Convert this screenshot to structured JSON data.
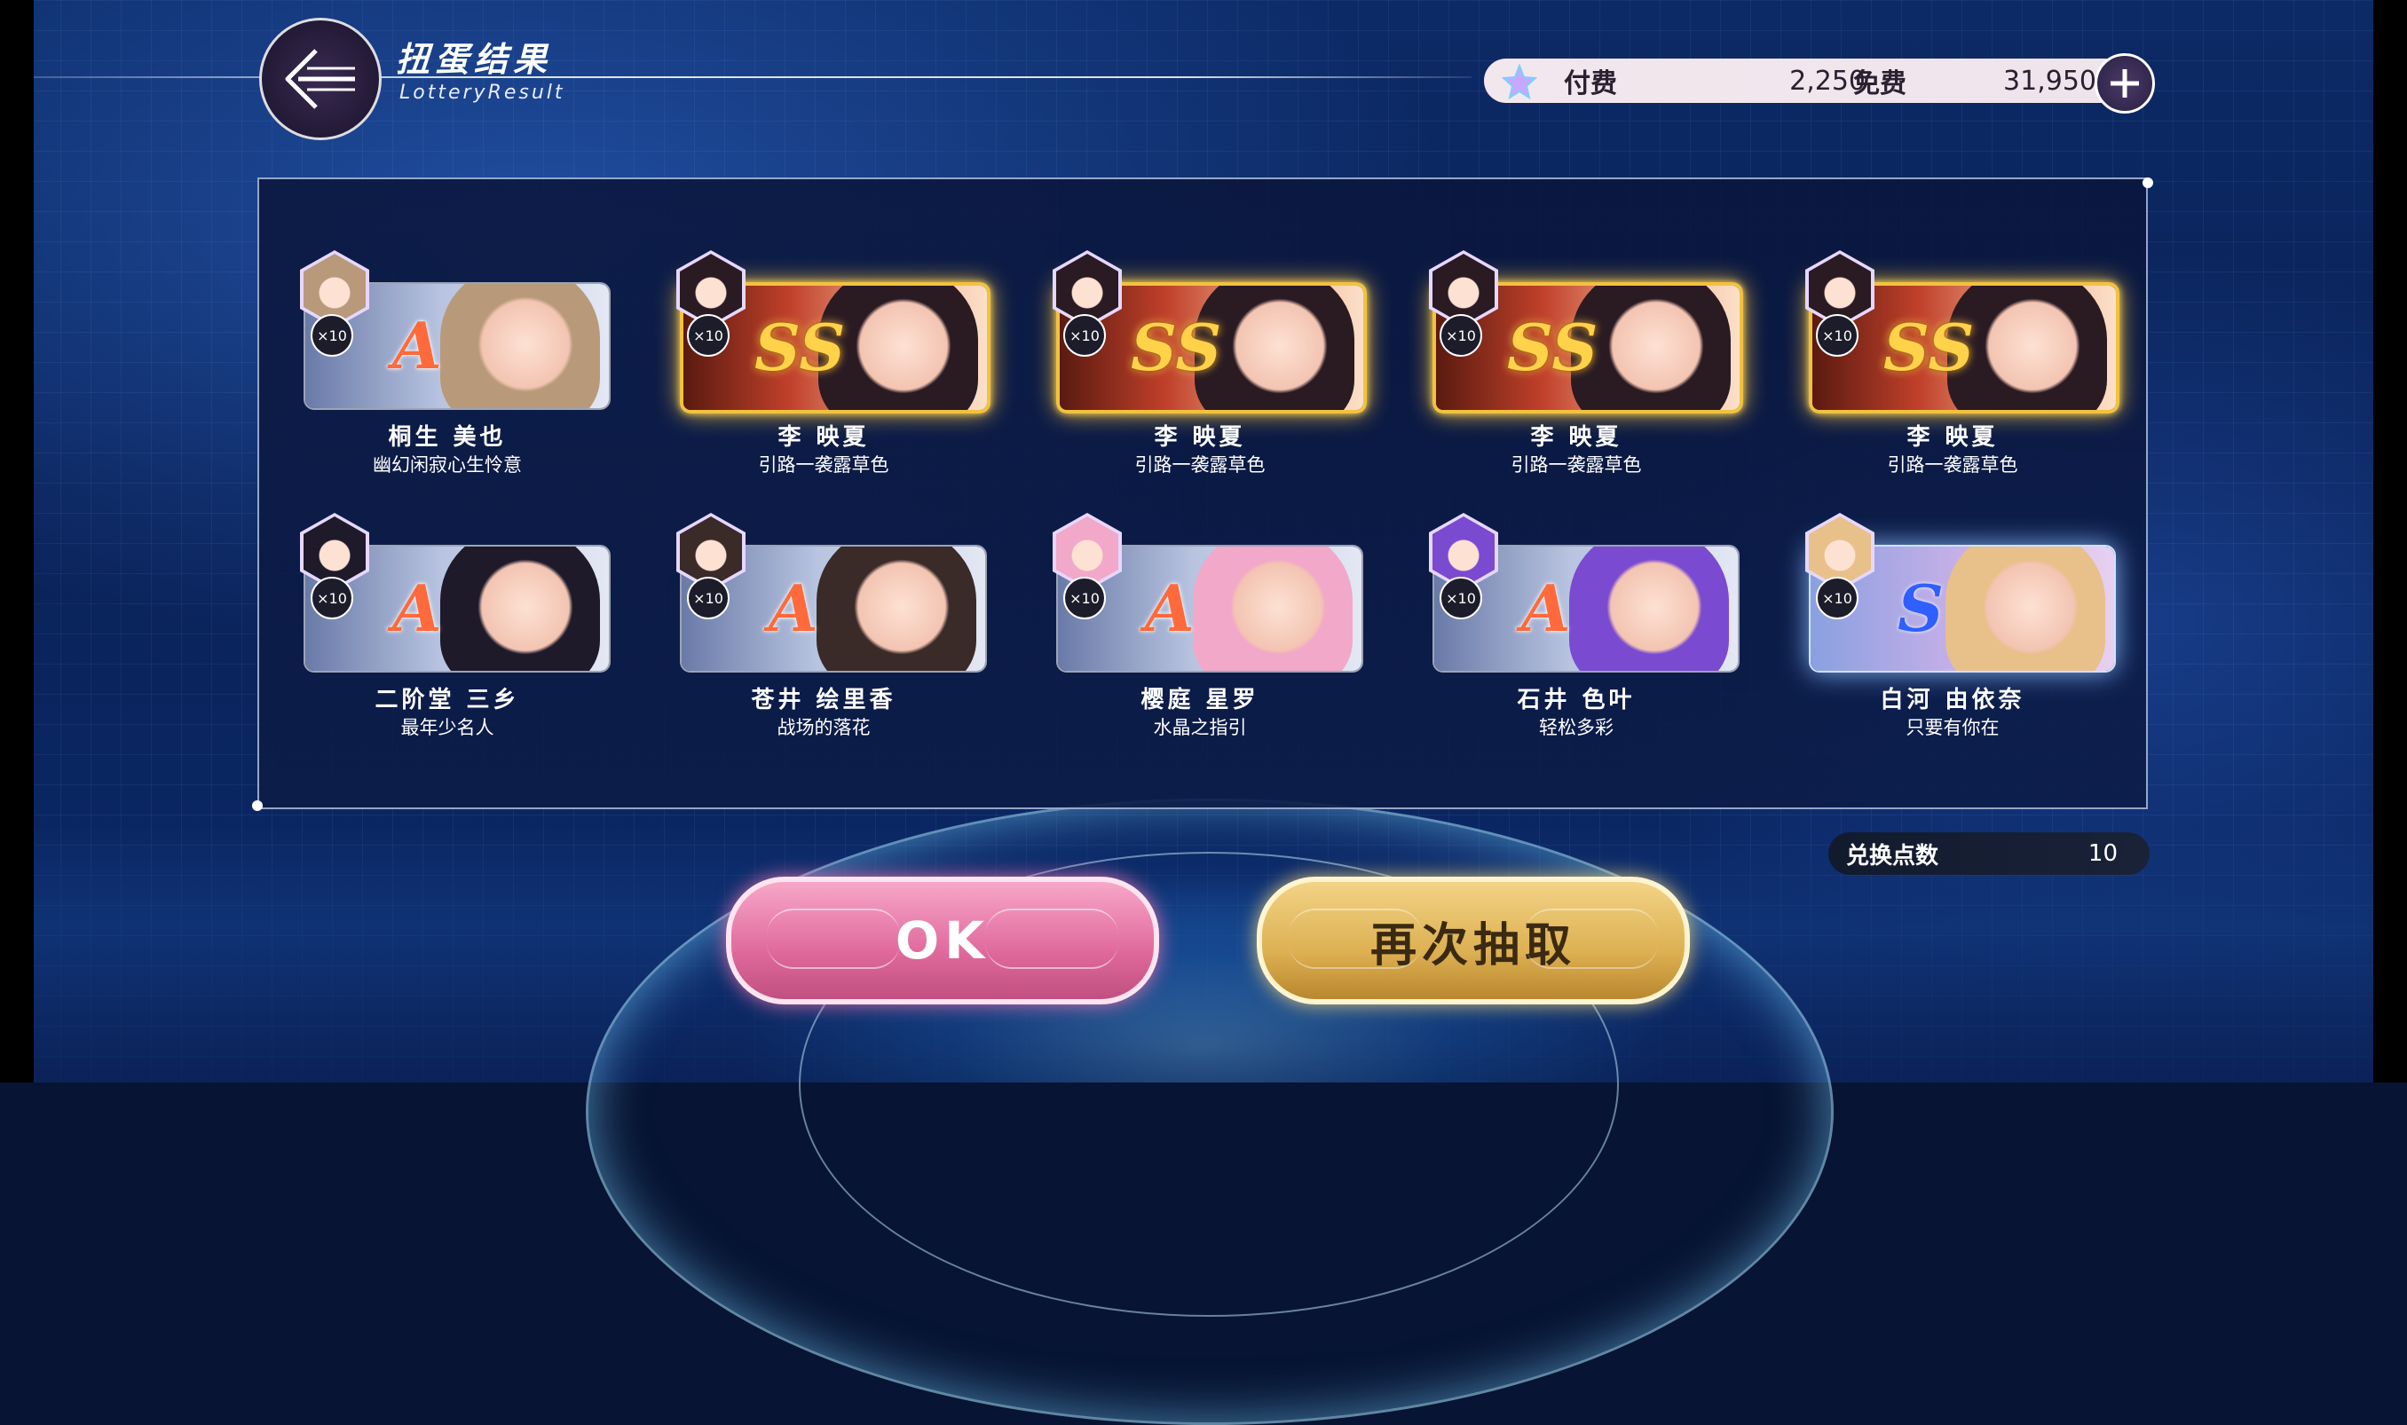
{
  "header": {
    "title_cn": "扭蛋结果",
    "title_en": "LotteryResult"
  },
  "currency": {
    "paid_label": "付费",
    "paid_value": "2,250",
    "free_label": "免费",
    "free_value": "31,950"
  },
  "results": [
    {
      "name": "桐生 美也",
      "title": "幽幻闲寂心生怜意",
      "rank": "A",
      "count": "×10",
      "hair": "#b89a7a"
    },
    {
      "name": "李 映夏",
      "title": "引路一袭露草色",
      "rank": "SS",
      "count": "×10",
      "hair": "#2a1a22"
    },
    {
      "name": "李 映夏",
      "title": "引路一袭露草色",
      "rank": "SS",
      "count": "×10",
      "hair": "#2a1a22"
    },
    {
      "name": "李 映夏",
      "title": "引路一袭露草色",
      "rank": "SS",
      "count": "×10",
      "hair": "#2a1a22"
    },
    {
      "name": "李 映夏",
      "title": "引路一袭露草色",
      "rank": "SS",
      "count": "×10",
      "hair": "#2a1a22"
    },
    {
      "name": "二阶堂 三乡",
      "title": "最年少名人",
      "rank": "A",
      "count": "×10",
      "hair": "#1e1a2a"
    },
    {
      "name": "苍井 绘里香",
      "title": "战场的落花",
      "rank": "A",
      "count": "×10",
      "hair": "#3a2a28"
    },
    {
      "name": "樱庭 星罗",
      "title": "水晶之指引",
      "rank": "A",
      "count": "×10",
      "hair": "#f2a8c8"
    },
    {
      "name": "石井 色叶",
      "title": "轻松多彩",
      "rank": "A",
      "count": "×10",
      "hair": "#7a4ad0"
    },
    {
      "name": "白河 由依奈",
      "title": "只要有你在",
      "rank": "S",
      "count": "×10",
      "hair": "#e8c08a"
    }
  ],
  "exchange": {
    "label": "兑换点数",
    "value": "10"
  },
  "buttons": {
    "ok": "OK",
    "again": "再次抽取"
  }
}
